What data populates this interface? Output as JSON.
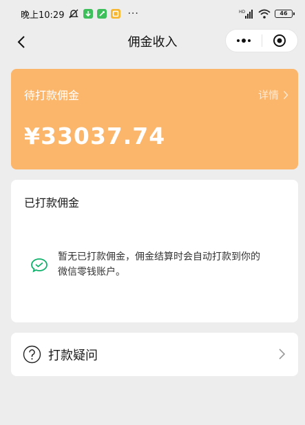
{
  "status_bar": {
    "time": "晚上10:29",
    "dots": "···",
    "network": "HD",
    "battery": "46",
    "app_badge_colors": [
      "#3fbf5c",
      "#3fbf5c",
      "#f7b733"
    ]
  },
  "nav": {
    "title": "佣金收入"
  },
  "pending": {
    "label": "待打款佣金",
    "detail_label": "详情",
    "amount": "¥33037.74",
    "bg_color": "#fbb66b"
  },
  "paid": {
    "label": "已打款佣金",
    "empty_message": "暂无已打款佣金，佣金结算时会自动打款到你的微信零钱账户。",
    "icon": "wechat-pay-icon",
    "icon_color": "#0fb16b"
  },
  "faq": {
    "label": "打款疑问",
    "icon": "question-circle-icon"
  }
}
